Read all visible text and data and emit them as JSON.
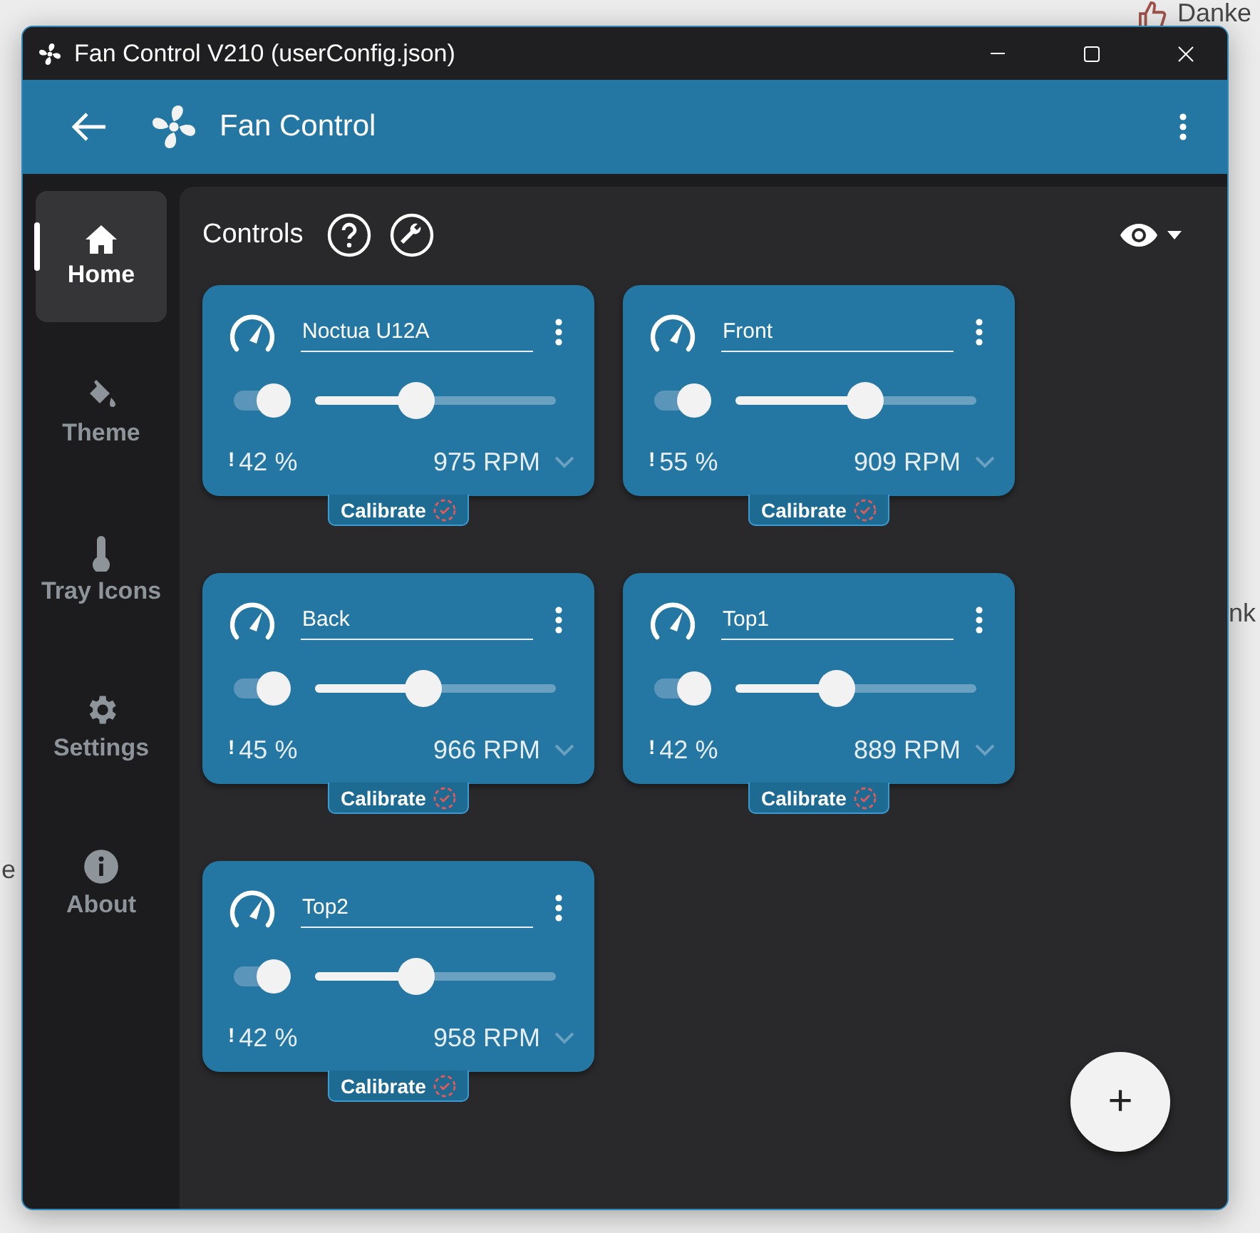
{
  "background": {
    "texts": [
      "Danke",
      "nk",
      "e"
    ]
  },
  "window": {
    "title": "Fan Control V210 (userConfig.json)"
  },
  "header": {
    "title": "Fan Control"
  },
  "sidebar": {
    "items": [
      {
        "label": "Home",
        "selected": true
      },
      {
        "label": "Theme",
        "selected": false
      },
      {
        "label": "Tray Icons",
        "selected": false
      },
      {
        "label": "Settings",
        "selected": false
      },
      {
        "label": "About",
        "selected": false
      }
    ]
  },
  "section": {
    "title": "Controls"
  },
  "controls": [
    {
      "name": "Noctua U12A",
      "enabled": true,
      "level": 0.42,
      "percent": "42 %",
      "rpm": "975 RPM",
      "calibrate": "Calibrate"
    },
    {
      "name": "Front",
      "enabled": true,
      "level": 0.54,
      "percent": "55 %",
      "rpm": "909 RPM",
      "calibrate": "Calibrate"
    },
    {
      "name": "Back",
      "enabled": true,
      "level": 0.45,
      "percent": "45 %",
      "rpm": "966 RPM",
      "calibrate": "Calibrate"
    },
    {
      "name": "Top1",
      "enabled": true,
      "level": 0.42,
      "percent": "42 %",
      "rpm": "889 RPM",
      "calibrate": "Calibrate"
    },
    {
      "name": "Top2",
      "enabled": true,
      "level": 0.42,
      "percent": "42 %",
      "rpm": "958 RPM",
      "calibrate": "Calibrate"
    }
  ],
  "warning_mark": "!",
  "fab": {
    "label": "+"
  }
}
